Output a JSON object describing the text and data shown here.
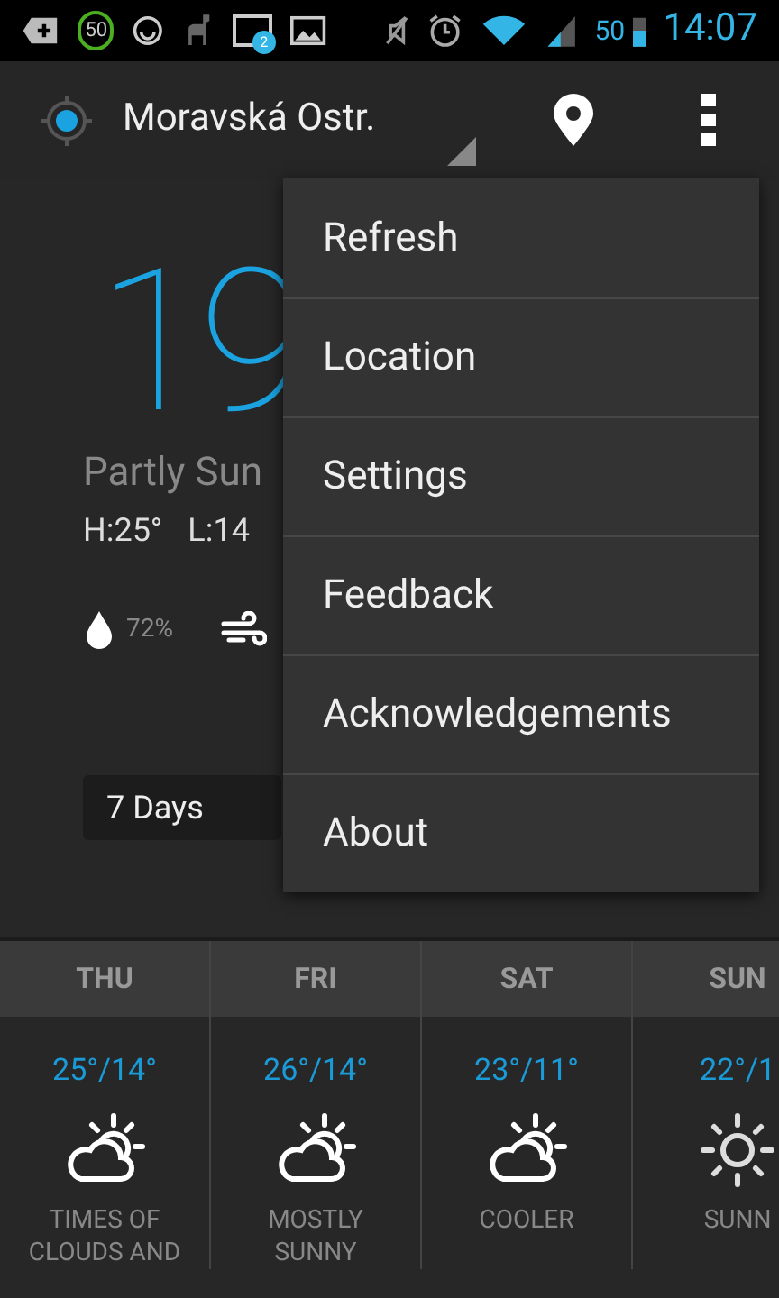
{
  "status_bar": {
    "notification_badge": "50",
    "mail_count": "2",
    "battery": "50",
    "time": "14:07"
  },
  "action_bar": {
    "location": "Moravská Ostr."
  },
  "current": {
    "temperature": "19",
    "condition": "Partly Sun",
    "high": "H:25°",
    "low": "L:14",
    "humidity": "72%"
  },
  "range_dropdown": {
    "value": "7 Days"
  },
  "forecast": [
    {
      "day": "THU",
      "temps": "25°/14°",
      "kind": "partly-cloudy",
      "summary": "TIMES OF CLOUDS AND"
    },
    {
      "day": "FRI",
      "temps": "26°/14°",
      "kind": "partly-cloudy",
      "summary": "MOSTLY SUNNY"
    },
    {
      "day": "SAT",
      "temps": "23°/11°",
      "kind": "partly-cloudy",
      "summary": "COOLER"
    },
    {
      "day": "SUN",
      "temps": "22°/1",
      "kind": "sunny",
      "summary": "SUNN"
    }
  ],
  "menu": [
    "Refresh",
    "Location",
    "Settings",
    "Feedback",
    "Acknowledgements",
    "About"
  ]
}
